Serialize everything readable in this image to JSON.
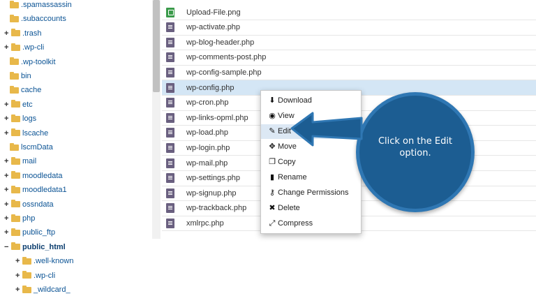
{
  "tree": [
    {
      "label": ".spamassassin",
      "toggle": ""
    },
    {
      "label": ".subaccounts",
      "toggle": ""
    },
    {
      "label": ".trash",
      "toggle": "+"
    },
    {
      "label": ".wp-cli",
      "toggle": "+"
    },
    {
      "label": ".wp-toolkit",
      "toggle": ""
    },
    {
      "label": "bin",
      "toggle": ""
    },
    {
      "label": "cache",
      "toggle": ""
    },
    {
      "label": "etc",
      "toggle": "+"
    },
    {
      "label": "logs",
      "toggle": "+"
    },
    {
      "label": "lscache",
      "toggle": "+"
    },
    {
      "label": "lscmData",
      "toggle": ""
    },
    {
      "label": "mail",
      "toggle": "+"
    },
    {
      "label": "moodledata",
      "toggle": "+"
    },
    {
      "label": "moodledata1",
      "toggle": "+"
    },
    {
      "label": "ossndata",
      "toggle": "+"
    },
    {
      "label": "php",
      "toggle": "+"
    },
    {
      "label": "public_ftp",
      "toggle": "+"
    },
    {
      "label": "public_html",
      "toggle": "−"
    },
    {
      "label": ".well-known",
      "toggle": "+"
    },
    {
      "label": ".wp-cli",
      "toggle": "+"
    },
    {
      "label": "_wildcard_",
      "toggle": "+"
    }
  ],
  "files": [
    "Upload-File.png",
    "wp-activate.php",
    "wp-blog-header.php",
    "wp-comments-post.php",
    "wp-config-sample.php",
    "wp-config.php",
    "wp-cron.php",
    "wp-links-opml.php",
    "wp-load.php",
    "wp-login.php",
    "wp-mail.php",
    "wp-settings.php",
    "wp-signup.php",
    "wp-trackback.php",
    "xmlrpc.php"
  ],
  "context_menu": [
    {
      "label": "Download",
      "icon": "download-icon",
      "glyph": "⬇"
    },
    {
      "label": "View",
      "icon": "eye-icon",
      "glyph": "◉"
    },
    {
      "label": "Edit",
      "icon": "pencil-icon",
      "glyph": "✎"
    },
    {
      "label": "Move",
      "icon": "move-icon",
      "glyph": "✥"
    },
    {
      "label": "Copy",
      "icon": "copy-icon",
      "glyph": "❐"
    },
    {
      "label": "Rename",
      "icon": "file-icon",
      "glyph": "▮"
    },
    {
      "label": "Change Permissions",
      "icon": "key-icon",
      "glyph": "⚷"
    },
    {
      "label": "Delete",
      "icon": "times-icon",
      "glyph": "✖"
    },
    {
      "label": "Compress",
      "icon": "compress-icon",
      "glyph": "⤢"
    }
  ],
  "callout": {
    "text": "Click on the Edit option."
  },
  "colors": {
    "accent": "#1c5d92",
    "selected_row": "#d4e6f5",
    "folder": "#e8b84a"
  }
}
